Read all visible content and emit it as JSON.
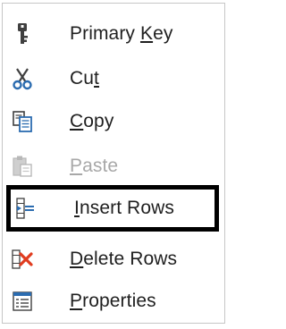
{
  "menu": {
    "items": [
      {
        "icon": "primary-key-icon",
        "pre": "Primary ",
        "u": "K",
        "post": "ey",
        "disabled": false
      },
      {
        "icon": "scissors-icon",
        "pre": "Cu",
        "u": "t",
        "post": "",
        "disabled": false
      },
      {
        "icon": "copy-icon",
        "pre": "",
        "u": "C",
        "post": "opy",
        "disabled": false
      },
      {
        "icon": "paste-icon",
        "pre": "",
        "u": "P",
        "post": "aste",
        "disabled": true
      },
      {
        "icon": "insert-rows-icon",
        "pre": "",
        "u": "I",
        "post": "nsert Rows",
        "disabled": false,
        "highlighted": true
      },
      {
        "icon": "delete-rows-icon",
        "pre": "",
        "u": "D",
        "post": "elete Rows",
        "disabled": false
      },
      {
        "icon": "properties-icon",
        "pre": "",
        "u": "P",
        "post": "roperties",
        "disabled": false
      }
    ]
  },
  "colors": {
    "icon_gray": "#444444",
    "icon_blue": "#2b6cb0",
    "delete_red": "#e03c1f",
    "disabled_text": "#a8a8a8",
    "highlight_border": "#000000"
  }
}
